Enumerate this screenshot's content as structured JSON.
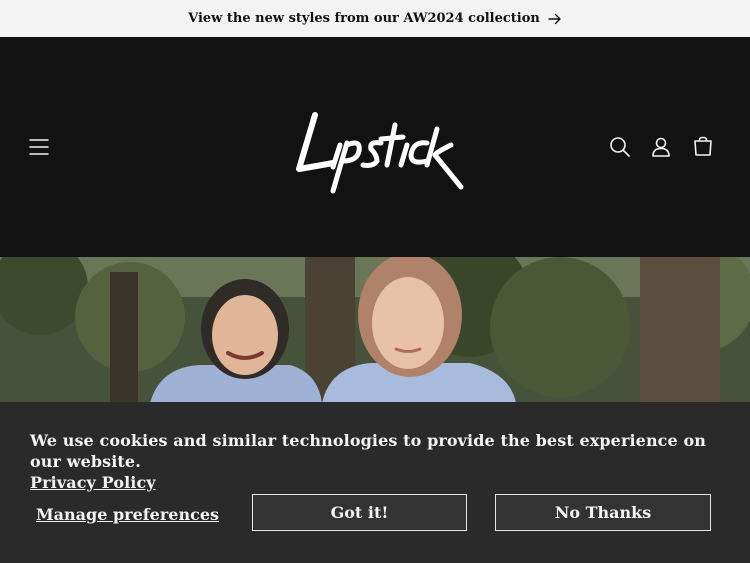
{
  "announcement": {
    "text": "View the new styles from our AW2024 collection"
  },
  "header": {
    "brand": "Lipstick",
    "icons": [
      "menu-icon",
      "search-icon",
      "account-icon",
      "cart-icon"
    ]
  },
  "colors": {
    "header_bg": "#121212",
    "announce_bg": "#f3f3f3",
    "cookie_bg": "#2a2a2a",
    "text_light": "#f3f3f3"
  },
  "cookie_banner": {
    "message": "We use cookies and similar technologies to provide the best experience on our website.",
    "policy_link": "Privacy Policy",
    "manage_label": "Manage preferences",
    "accept_label": "Got it!",
    "decline_label": "No Thanks"
  }
}
